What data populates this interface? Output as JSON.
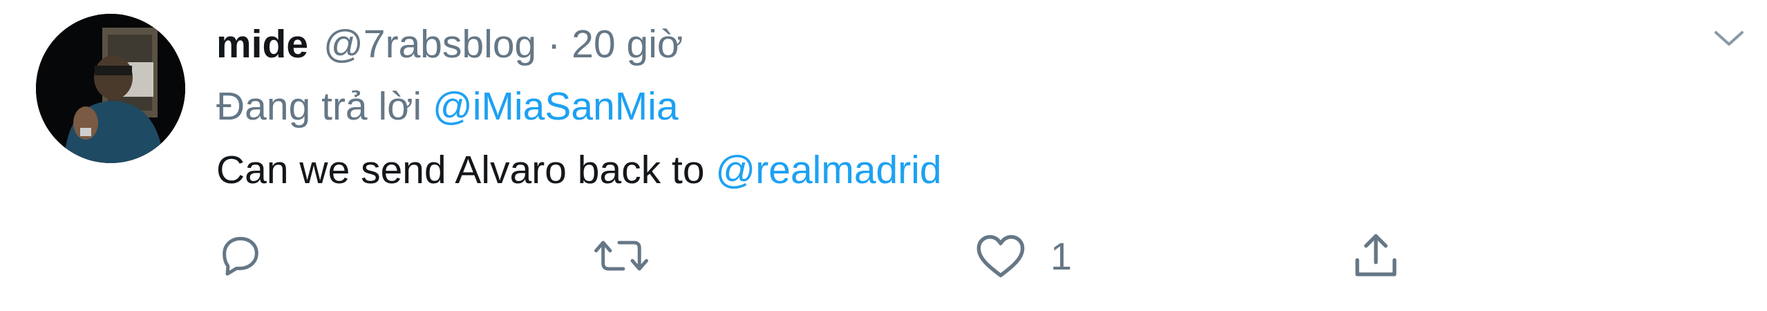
{
  "tweet": {
    "display_name": "mide",
    "handle": "@7rabsblog",
    "separator": "·",
    "timestamp": "20 giờ",
    "reply_prefix": "Đang trả lời",
    "reply_to": "@iMiaSanMia",
    "text": "Can we send Alvaro back to",
    "text_mention": "@realmadrid"
  },
  "actions": {
    "reply_count": "",
    "retweet_count": "",
    "like_count": "1",
    "share_count": ""
  },
  "colors": {
    "link": "#1da1f2",
    "secondary": "#657786",
    "primary_text": "#14171a"
  },
  "icons": [
    "avatar",
    "chevron-down-icon",
    "reply-icon",
    "retweet-icon",
    "like-icon",
    "share-icon"
  ]
}
